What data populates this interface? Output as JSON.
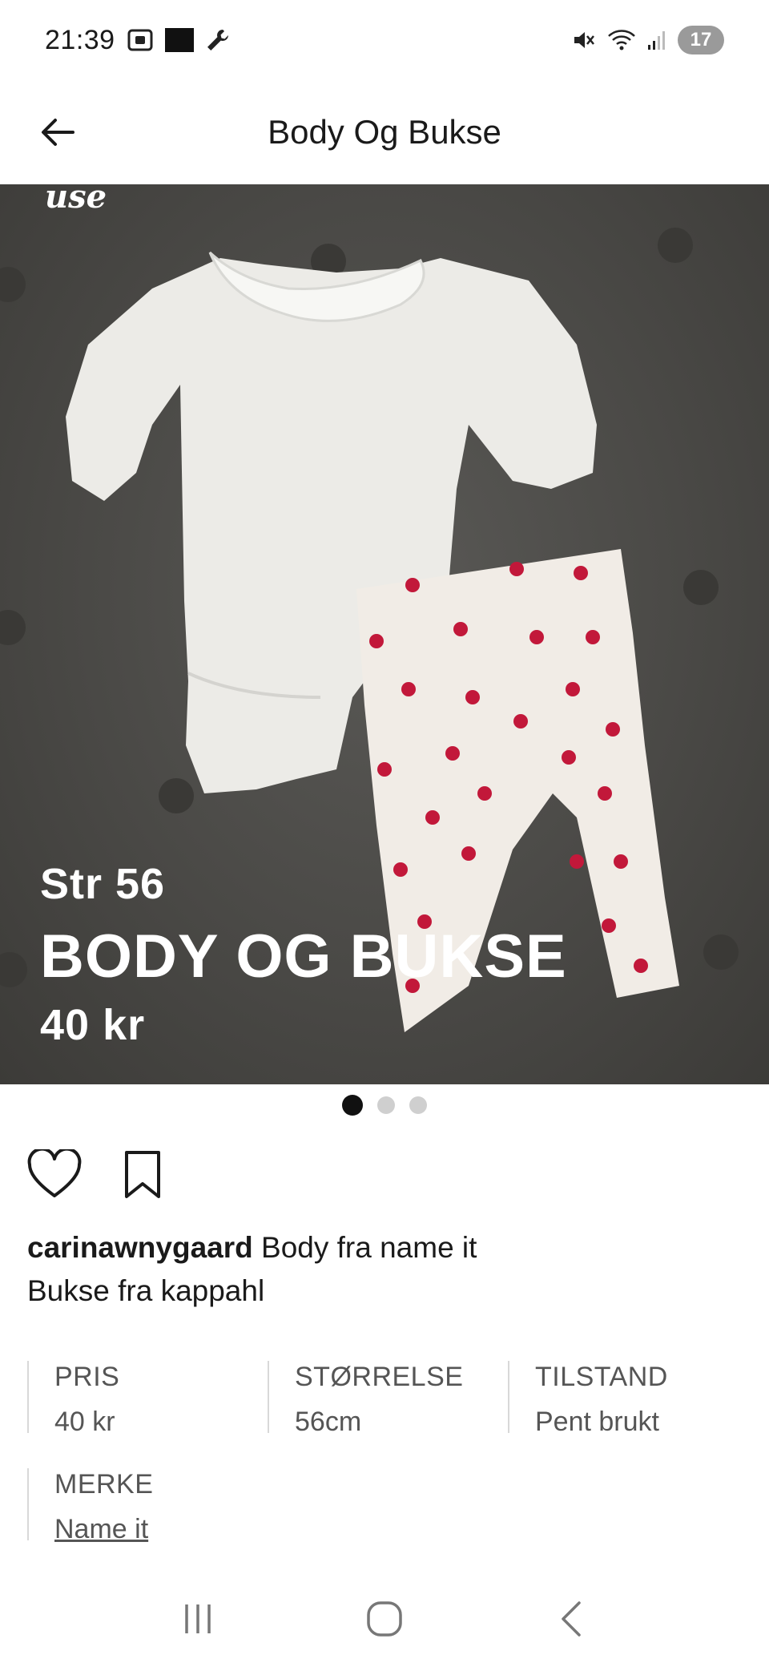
{
  "status_bar": {
    "time": "21:39",
    "notification_count": "17",
    "icons": [
      "screenshot-icon",
      "app-logo-icon",
      "wrench-icon",
      "mute-icon",
      "wifi-icon",
      "signal-icon"
    ]
  },
  "app_bar": {
    "title": "Body Og Bukse",
    "back_icon": "arrow-left-icon"
  },
  "photo": {
    "watermark": "use",
    "overlay_size": "Str 56",
    "overlay_title": "BODY OG BUKSE",
    "overlay_price": "40 kr",
    "carousel_count": 3,
    "carousel_active": 0
  },
  "actions": {
    "like_icon": "heart-icon",
    "save_icon": "bookmark-icon"
  },
  "description": {
    "username": "carinawnygaard",
    "line1": " Body fra name it",
    "line2": "Bukse fra kappahl"
  },
  "attributes": {
    "price": {
      "label": "PRIS",
      "value": "40 kr"
    },
    "size": {
      "label": "STØRRELSE",
      "value": "56cm"
    },
    "condition": {
      "label": "TILSTAND",
      "value": "Pent brukt"
    },
    "brand": {
      "label": "MERKE",
      "value": "Name it"
    }
  },
  "navbar": {
    "recents_icon": "recents-icon",
    "home_icon": "home-icon",
    "back_icon": "nav-back-icon"
  },
  "colors": {
    "photo_background": "#4a4946",
    "heart_print": "#c2183a",
    "active_dot": "#111111",
    "inactive_dot": "#cfcfcf"
  }
}
